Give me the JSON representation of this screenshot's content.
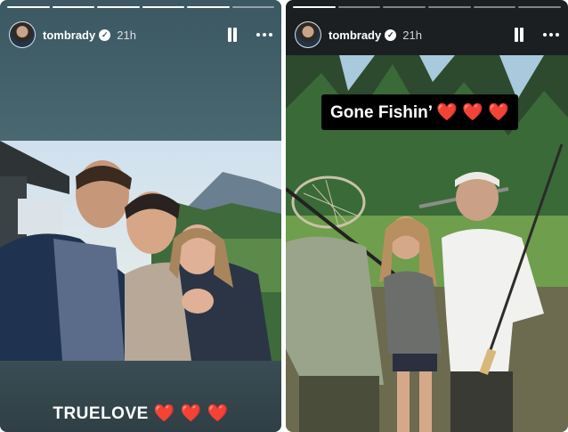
{
  "stories": [
    {
      "username": "tombrady",
      "verified_badge": "✓",
      "timestamp": "21h",
      "caption_text": "TRUELOVE",
      "caption_hearts": "❤️ ❤️ ❤️",
      "progress": [
        1,
        1,
        1,
        1,
        1,
        0
      ]
    },
    {
      "username": "tombrady",
      "verified_badge": "✓",
      "timestamp": "21h",
      "caption_text": "Gone Fishin’",
      "caption_hearts": "❤️ ❤️ ❤️",
      "progress": [
        1,
        0,
        0,
        0,
        0,
        0
      ]
    }
  ],
  "icons": {
    "pause": "pause-icon",
    "more": "more-options-icon",
    "verified": "verified-badge-icon"
  },
  "colors": {
    "left_story_bg": "#3d5660",
    "right_story_bg": "#1b1f22",
    "heart": "#e8202a"
  }
}
